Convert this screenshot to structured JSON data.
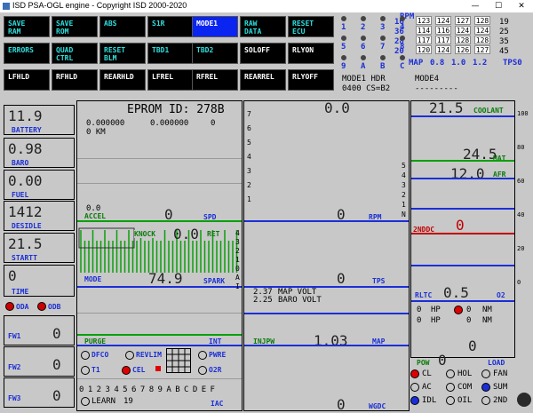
{
  "window": {
    "title": "ISD PSA-OGL engine - Copyright ISD 2000-2020",
    "min": "—",
    "max": "☐",
    "close": "✕"
  },
  "buttons": [
    {
      "id": "save-ram",
      "l1": "SAVE",
      "l2": "RAM",
      "style": "c"
    },
    {
      "id": "save-rom",
      "l1": "SAVE",
      "l2": "ROM",
      "style": "c"
    },
    {
      "id": "abs",
      "l1": "ABS",
      "l2": "",
      "style": "c"
    },
    {
      "id": "s1r",
      "l1": "S1R",
      "l2": "",
      "style": "c"
    },
    {
      "id": "mode1",
      "l1": "MODE1",
      "l2": "",
      "style": "sel"
    },
    {
      "id": "raw-data",
      "l1": "RAW",
      "l2": "DATA",
      "style": "c"
    },
    {
      "id": "reset-ecu",
      "l1": "RESET",
      "l2": "ECU",
      "style": "c"
    },
    {
      "id": "errors",
      "l1": "ERRORS",
      "l2": "",
      "style": "c"
    },
    {
      "id": "quad-ctrl",
      "l1": "QUAD",
      "l2": "CTRL",
      "style": "c"
    },
    {
      "id": "reset-blm",
      "l1": "RESET",
      "l2": "BLM",
      "style": "c"
    },
    {
      "id": "tbd1",
      "l1": "TBD1",
      "l2": "",
      "style": "c"
    },
    {
      "id": "tbd2",
      "l1": "TBD2",
      "l2": "",
      "style": "c"
    },
    {
      "id": "soloff",
      "l1": "SOLOFF",
      "l2": "",
      "style": "w"
    },
    {
      "id": "rlyon",
      "l1": "RLYON",
      "l2": "",
      "style": "w"
    },
    {
      "id": "lfhld",
      "l1": "LFHLD",
      "l2": "",
      "style": "w"
    },
    {
      "id": "rfhld",
      "l1": "RFHLD",
      "l2": "",
      "style": "w"
    },
    {
      "id": "rearhld",
      "l1": "REARHLD",
      "l2": "",
      "style": "w"
    },
    {
      "id": "lfrel",
      "l1": "LFREL",
      "l2": "",
      "style": "w"
    },
    {
      "id": "rfrel",
      "l1": "RFREL",
      "l2": "",
      "style": "w"
    },
    {
      "id": "rearrel",
      "l1": "REARREL",
      "l2": "",
      "style": "w"
    },
    {
      "id": "rlyoff",
      "l1": "RLYOFF",
      "l2": "",
      "style": "w"
    }
  ],
  "rpm_grid": {
    "label": "RPM",
    "rows_left": [
      "16",
      "36",
      "28",
      "20"
    ],
    "rows": [
      [
        "123",
        "124",
        "127",
        "128"
      ],
      [
        "114",
        "116",
        "124",
        "124"
      ],
      [
        "117",
        "117",
        "128",
        "128"
      ],
      [
        "120",
        "124",
        "126",
        "127"
      ]
    ],
    "rows_right": [
      "19",
      "25",
      "35",
      "45"
    ],
    "map_label": "MAP",
    "map_vals": [
      "0.8",
      "1.0",
      "1.2"
    ],
    "tps_label": "TPS0"
  },
  "dot_grid": {
    "rows": [
      [
        "1",
        "2",
        "3",
        "4"
      ],
      [
        "5",
        "6",
        "7",
        "8"
      ],
      [
        "9",
        "A",
        "B",
        "C"
      ]
    ]
  },
  "mode_info": {
    "mode_line": "MODE1 HDR",
    "mode4": "MODE4",
    "addr": "0400 CS=B2",
    "dashes": "---------"
  },
  "left_gauges": [
    {
      "name": "battery",
      "value": "11.9",
      "label": "BATTERY"
    },
    {
      "name": "baro",
      "value": "0.98",
      "label": "BARO"
    },
    {
      "name": "fuel",
      "value": "0.00",
      "label": "FUEL"
    },
    {
      "name": "desidle",
      "value": "1412",
      "label": "DESIDLE"
    },
    {
      "name": "startt",
      "value": "21.5",
      "label": "STARTT"
    },
    {
      "name": "time",
      "value": "0",
      "label": "TIME"
    }
  ],
  "oda": "ODA",
  "odb": "ODB",
  "fw": [
    {
      "label": "FW1",
      "value": "0"
    },
    {
      "label": "FW2",
      "value": "0"
    },
    {
      "label": "FW3",
      "value": "0"
    }
  ],
  "eprom": {
    "title": "EPROM ID: 278B",
    "r1a": "0.000000",
    "r1b": "0.000000",
    "r1c": "0",
    "km": "0 KM"
  },
  "accel": {
    "value": "0.0",
    "label": "ACCEL",
    "spd": "SPD",
    "spd_val": "0"
  },
  "knock": {
    "label": "KNOCK",
    "ret_val": "0.0",
    "ret": "RET",
    "mode": "MODE",
    "spark": "SPARK",
    "spark_val": "74.9"
  },
  "knock_side": [
    "4",
    "3",
    "2",
    "1",
    "0",
    "A",
    "I"
  ],
  "purge": {
    "label": "PURGE",
    "int": "INT"
  },
  "checks": {
    "dfco": "DFCO",
    "revlim": "REVLIM",
    "pwre": "PWRE",
    "t1": "T1",
    "cel": "CEL",
    "o2r": "O2R"
  },
  "bits": "0 1 2 3 4 5 6 7 8 9 A B C D E F",
  "learn": {
    "label": "LEARN",
    "value": "19"
  },
  "iac": "IAC",
  "col3": {
    "top_val": "0.0",
    "rpm": "RPM",
    "rpm_val": "0",
    "scale": [
      "7",
      "6",
      "5",
      "4",
      "3",
      "2",
      "1"
    ],
    "tps": "TPS",
    "tps_val": "0",
    "mapvolt_val": "2.37",
    "mapvolt": "MAP VOLT",
    "barovolt_val": "2.25",
    "barovolt": "BARO VOLT",
    "injpw": "INJPW",
    "map_val": "1.03",
    "map": "MAP",
    "wgdc": "WGDC",
    "wgdc_val": "0"
  },
  "gear_side": [
    "5",
    "4",
    "3",
    "2",
    "1",
    "N"
  ],
  "col4": {
    "coolant": "COOLANT",
    "coolant_val": "21.5",
    "mat": "MAT",
    "mat_val": "24.5",
    "afr": "AFR",
    "afr_val": "12.0",
    "nddc": "2NDDC",
    "nddc_val": "0",
    "rltc": "RLTC",
    "rltc_val": "0.5",
    "o2": "O2",
    "hp1": "HP",
    "nm1": "NM",
    "hp2": "HP",
    "nm2": "NM",
    "hpv": "0",
    "nmv": "0",
    "hpv2": "0",
    "nmv2": "0",
    "pow": "POW",
    "load": "LOAD",
    "pow_val": "0",
    "load_val": "0",
    "scale": [
      "100",
      "80",
      "60",
      "40",
      "20",
      "0"
    ]
  },
  "legend": {
    "cl": "CL",
    "hol": "HOL",
    "fan": "FAN",
    "ac": "AC",
    "com": "COM",
    "sum": "SUM",
    "idl": "IDL",
    "oil": "OIL",
    "second": "2ND"
  }
}
